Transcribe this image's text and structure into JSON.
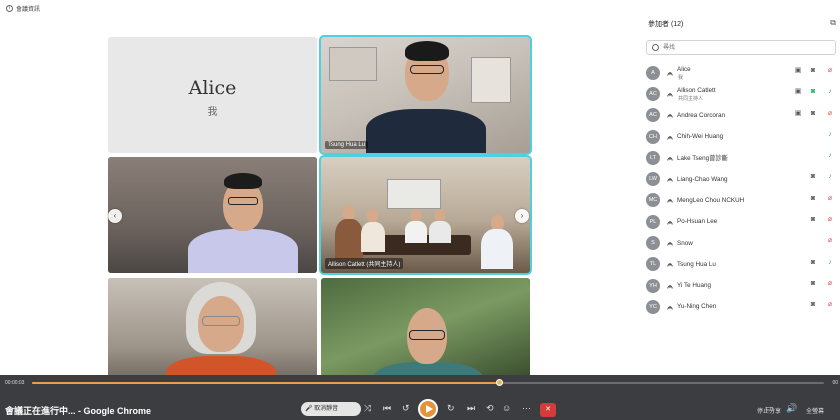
{
  "meeting": {
    "info_label": "會議資訊"
  },
  "tiles": {
    "alice": {
      "name": "Alice",
      "me": "我"
    },
    "tsung": {
      "label": "Tsung Hua Lu"
    },
    "allison": {
      "label": "Allison Catlett (共同主持人)"
    }
  },
  "panel": {
    "title": "參加者 (12)",
    "search_placeholder": "尋找",
    "participants": [
      {
        "initials": "A",
        "name": "Alice",
        "sub": "我",
        "mic": "muted",
        "cam": "off",
        "present": true
      },
      {
        "initials": "AC",
        "name": "Allison Catlett",
        "sub": "共同主持人",
        "mic": "on",
        "cam": "on",
        "present": true
      },
      {
        "initials": "AC",
        "name": "Andrea Corcoran",
        "mic": "muted",
        "cam": "off",
        "present": true
      },
      {
        "initials": "CH",
        "name": "Chih-Wei Huang",
        "mic": "on"
      },
      {
        "initials": "LT",
        "name": "Lake Tseng曾診斷",
        "mic": "on"
      },
      {
        "initials": "LW",
        "name": "Liang-Chao Wang",
        "mic": "on",
        "cam": "off"
      },
      {
        "initials": "MC",
        "name": "MengLeo Chou NCKUH",
        "mic": "muted",
        "cam": "off"
      },
      {
        "initials": "PL",
        "name": "Po-Hsuan Lee",
        "mic": "muted",
        "cam": "off"
      },
      {
        "initials": "S",
        "name": "Snow",
        "mic": "muted"
      },
      {
        "initials": "TL",
        "name": "Tsung Hua Lu",
        "mic": "on",
        "cam": "off"
      },
      {
        "initials": "YH",
        "name": "Yi Te Huang",
        "mic": "muted",
        "cam": "off"
      },
      {
        "initials": "YC",
        "name": "Yu-Ning Chen",
        "mic": "muted",
        "cam": "off"
      }
    ]
  },
  "player": {
    "time_current": "00:00:03",
    "time_end": "00",
    "progress": 0.59,
    "window_title": "會議正在進行中... - Google Chrome",
    "pill_label": "取消靜音",
    "right_label": "停止分享",
    "right_label_2": "全螢幕"
  },
  "colors": {
    "accent": "#4fd0e0",
    "muted": "#e05050",
    "on": "#2bb673",
    "progress": "#e6a04a"
  }
}
